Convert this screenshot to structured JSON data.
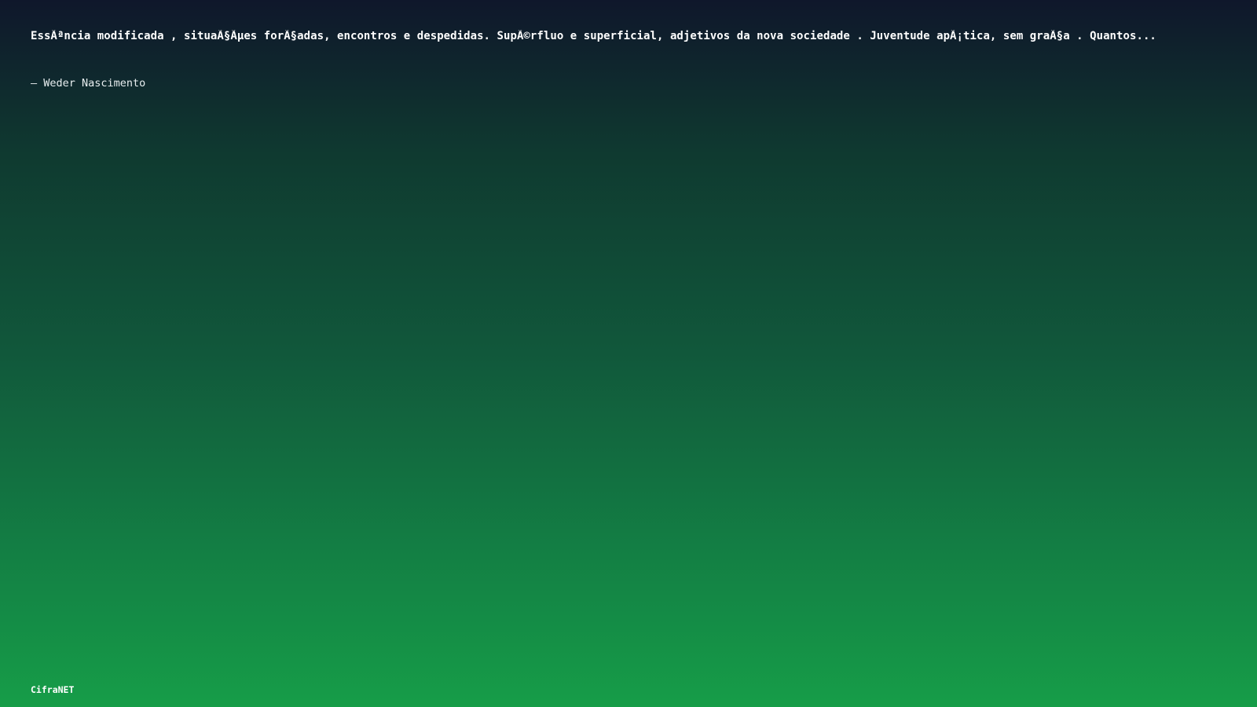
{
  "quote": {
    "text": "EssÃªncia modificada , situaÃ§Ãµes forÃ§adas, encontros e despedidas. SupÃ©rfluo e superficial, adjetivos da nova sociedade . Juventude apÃ¡tica, sem graÃ§a . Quantos..."
  },
  "author": {
    "line": "– Weder Nascimento"
  },
  "footer": {
    "brand": "CifraNET"
  },
  "colors": {
    "gradient_top": "#0f172b",
    "gradient_bottom": "#169d48",
    "text": "#ffffff"
  }
}
